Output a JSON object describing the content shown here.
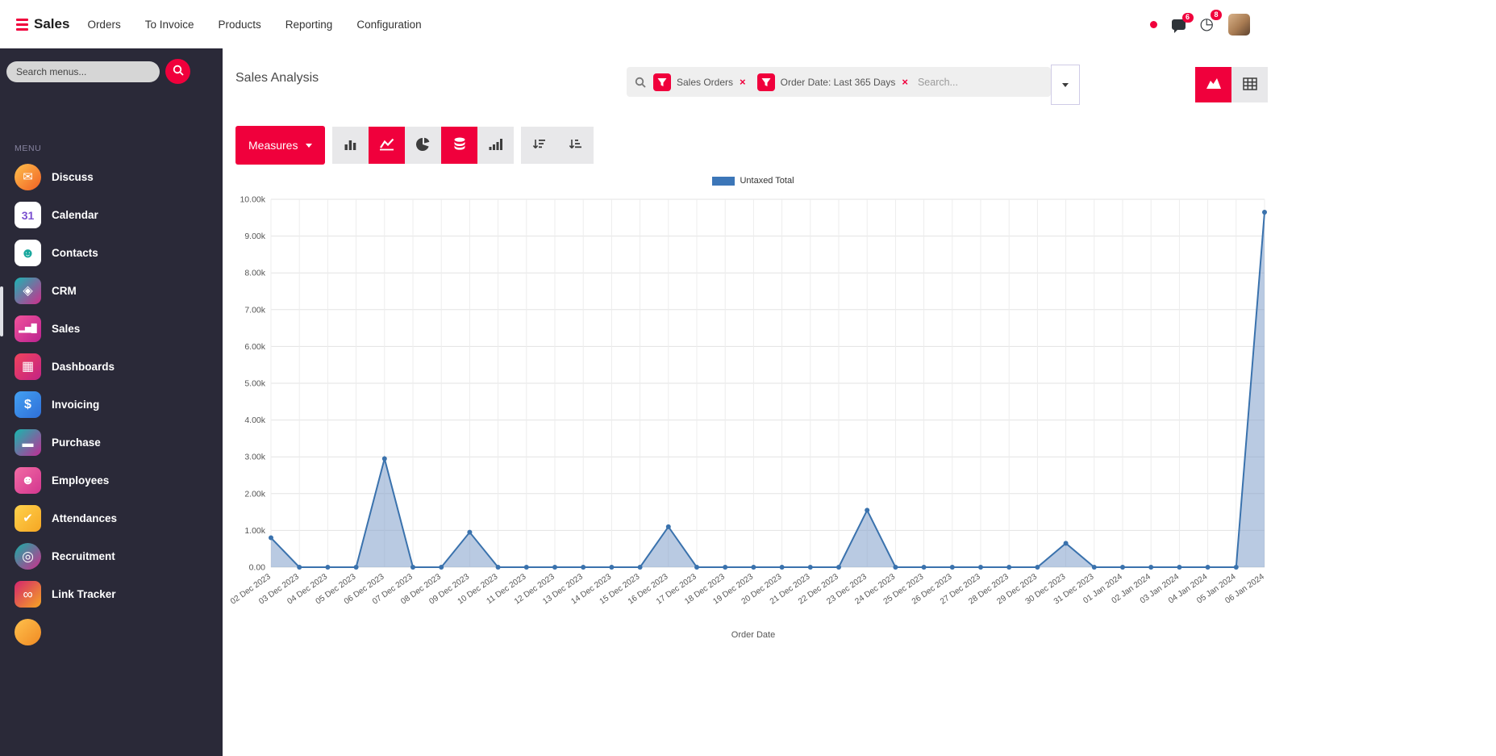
{
  "theme": {
    "accent": "#f0003c",
    "sidebar_bg": "#2a2938",
    "chart_line": "#3a72ad",
    "chart_fill": "rgba(127,158,202,0.55)",
    "legend_swatch": "#3c76b8"
  },
  "navbar": {
    "brand": "Sales",
    "items": [
      {
        "label": "Orders"
      },
      {
        "label": "To Invoice"
      },
      {
        "label": "Products"
      },
      {
        "label": "Reporting"
      },
      {
        "label": "Configuration"
      }
    ],
    "systray": {
      "messages_badge": "6",
      "activities_badge": "8"
    }
  },
  "sidebar": {
    "search_placeholder": "Search menus...",
    "menu_label": "MENU",
    "items": [
      {
        "label": "Discuss",
        "icon": "discuss-icon",
        "bg": "linear-gradient(135deg,#ffc14d,#f05f23)",
        "radius": "50%",
        "glyph": "✉",
        "glyph_color": "#fff",
        "glyph_size": 15
      },
      {
        "label": "Calendar",
        "icon": "calendar-icon",
        "bg": "#ffffff",
        "radius": "8px",
        "glyph": "31",
        "glyph_color": "#7a4fd0",
        "glyph_size": 14,
        "bold": true
      },
      {
        "label": "Contacts",
        "icon": "contacts-icon",
        "bg": "#ffffff",
        "radius": "8px",
        "glyph": "☻",
        "glyph_color": "#18a79d",
        "glyph_size": 17
      },
      {
        "label": "CRM",
        "icon": "crm-icon",
        "bg": "linear-gradient(135deg,#19b6b4,#cf2d8c)",
        "radius": "8px",
        "glyph": "◈",
        "glyph_color": "#fff",
        "glyph_size": 16
      },
      {
        "label": "Sales",
        "icon": "sales-icon",
        "bg": "linear-gradient(135deg,#f1539b,#bb2290)",
        "radius": "8px",
        "glyph": "▂▅█",
        "glyph_color": "#fff",
        "glyph_size": 10
      },
      {
        "label": "Dashboards",
        "icon": "dashboards-icon",
        "bg": "linear-gradient(135deg,#f0435c,#c32385)",
        "radius": "8px",
        "glyph": "▦",
        "glyph_color": "#fff",
        "glyph_size": 16
      },
      {
        "label": "Invoicing",
        "icon": "invoicing-icon",
        "bg": "linear-gradient(135deg,#43a0f2,#2f6fd8)",
        "radius": "8px",
        "glyph": "$",
        "glyph_color": "#fff",
        "glyph_size": 16,
        "bold": true
      },
      {
        "label": "Purchase",
        "icon": "purchase-icon",
        "bg": "linear-gradient(135deg,#16b8ae,#c12d96)",
        "radius": "8px",
        "glyph": "▬",
        "glyph_color": "#fff",
        "glyph_size": 14
      },
      {
        "label": "Employees",
        "icon": "employees-icon",
        "bg": "linear-gradient(135deg,#f26ba4,#d3368f)",
        "radius": "8px",
        "glyph": "☻",
        "glyph_color": "#fff",
        "glyph_size": 16
      },
      {
        "label": "Attendances",
        "icon": "attendances-icon",
        "bg": "linear-gradient(135deg,#ffd24d,#f5a623)",
        "radius": "8px",
        "glyph": "✔",
        "glyph_color": "#fff",
        "glyph_size": 15
      },
      {
        "label": "Recruitment",
        "icon": "recruitment-icon",
        "bg": "linear-gradient(135deg,#14b0a6,#cf2d8c)",
        "radius": "50%",
        "glyph": "◎",
        "glyph_color": "#fff",
        "glyph_size": 17
      },
      {
        "label": "Link Tracker",
        "icon": "link-tracker-icon",
        "bg": "linear-gradient(135deg,#d4246e,#f5a623)",
        "radius": "8px",
        "glyph": "∞",
        "glyph_color": "#fff",
        "glyph_size": 17
      },
      {
        "label": "",
        "icon": "partial-app-icon",
        "bg": "linear-gradient(135deg,#ffc14d,#f08a23)",
        "radius": "50%",
        "glyph": "",
        "glyph_color": "#fff",
        "glyph_size": 14
      }
    ]
  },
  "control_panel": {
    "title": "Sales Analysis",
    "facets": [
      {
        "label": "Sales Orders"
      },
      {
        "label": "Order Date: Last 365 Days"
      }
    ],
    "search_placeholder": "Search...",
    "view_switcher": [
      {
        "name": "graph-view-button",
        "icon": "area-chart-icon",
        "active": true
      },
      {
        "name": "pivot-view-button",
        "icon": "grid-icon",
        "active": false
      }
    ]
  },
  "toolbar": {
    "measures_label": "Measures",
    "chart_type_buttons": [
      {
        "name": "bar-chart-button",
        "icon": "bar-chart-icon",
        "active": false
      },
      {
        "name": "line-chart-button",
        "icon": "line-chart-icon",
        "active": true
      },
      {
        "name": "pie-chart-button",
        "icon": "pie-chart-icon",
        "active": false
      },
      {
        "name": "stacked-button",
        "icon": "database-icon",
        "active": true
      },
      {
        "name": "cumulative-button",
        "icon": "signal-icon",
        "active": false
      }
    ],
    "sort_buttons": [
      {
        "name": "sort-descending-button",
        "icon": "sort-desc-icon",
        "active": false
      },
      {
        "name": "sort-ascending-button",
        "icon": "sort-asc-icon",
        "active": false
      }
    ]
  },
  "chart_data": {
    "type": "line",
    "title": "",
    "xlabel": "Order Date",
    "ylabel": "",
    "ylim": [
      0,
      10000
    ],
    "ytick_step": 1000,
    "ytick_labels": [
      "0.00",
      "1.00k",
      "2.00k",
      "3.00k",
      "4.00k",
      "5.00k",
      "6.00k",
      "7.00k",
      "8.00k",
      "9.00k",
      "10.00k"
    ],
    "grid": true,
    "legend_position": "top-center",
    "x": [
      "02 Dec 2023",
      "03 Dec 2023",
      "04 Dec 2023",
      "05 Dec 2023",
      "06 Dec 2023",
      "07 Dec 2023",
      "08 Dec 2023",
      "09 Dec 2023",
      "10 Dec 2023",
      "11 Dec 2023",
      "12 Dec 2023",
      "13 Dec 2023",
      "14 Dec 2023",
      "15 Dec 2023",
      "16 Dec 2023",
      "17 Dec 2023",
      "18 Dec 2023",
      "19 Dec 2023",
      "20 Dec 2023",
      "21 Dec 2023",
      "22 Dec 2023",
      "23 Dec 2023",
      "24 Dec 2023",
      "25 Dec 2023",
      "26 Dec 2023",
      "27 Dec 2023",
      "28 Dec 2023",
      "29 Dec 2023",
      "30 Dec 2023",
      "31 Dec 2023",
      "01 Jan 2024",
      "02 Jan 2024",
      "03 Jan 2024",
      "04 Jan 2024",
      "05 Jan 2024",
      "06 Jan 2024"
    ],
    "series": [
      {
        "name": "Untaxed Total",
        "values": [
          800,
          0,
          0,
          0,
          2950,
          0,
          0,
          950,
          0,
          0,
          0,
          0,
          0,
          0,
          1100,
          0,
          0,
          0,
          0,
          0,
          0,
          1550,
          0,
          0,
          0,
          0,
          0,
          0,
          650,
          0,
          0,
          0,
          0,
          0,
          0,
          9650
        ]
      }
    ]
  }
}
